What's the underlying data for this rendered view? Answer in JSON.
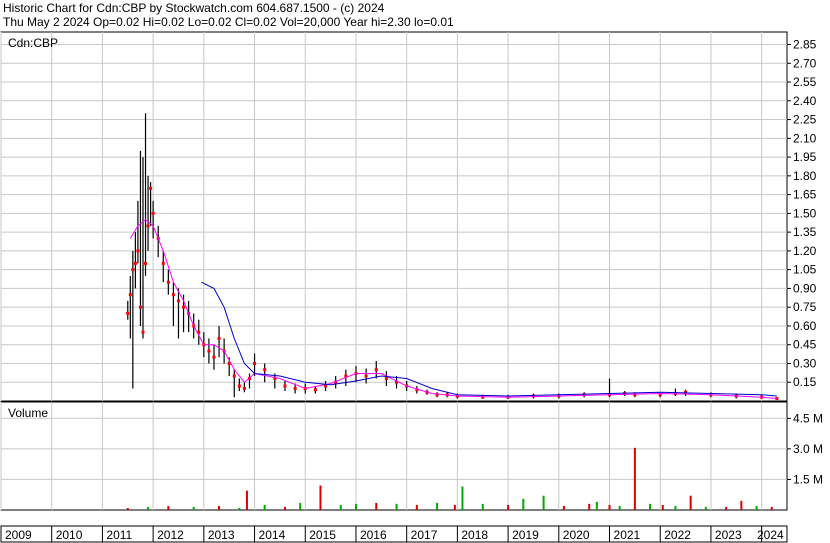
{
  "header": {
    "line1": "Historic Chart for Cdn:CBP by Stockwatch.com 604.687.1500 - (c) 2024",
    "line2": "Thu May  2 2024  Op=0.02  Hi=0.02  Lo=0.02  Cl=0.02  Vol=20,000  Year hi=2.30  lo=0.01"
  },
  "colors": {
    "price_bar": "#000000",
    "price_dot": "#ff0000",
    "ma_short": "#ff00ff",
    "ma_long": "#0000cc",
    "vol_up": "#00aa00",
    "vol_down": "#dd0000",
    "grid": "#c8c8c8"
  },
  "chart_data": [
    {
      "type": "line",
      "title": "Cdn:CBP",
      "y_ticks": [
        "2.85",
        "2.70",
        "2.55",
        "2.40",
        "2.25",
        "2.10",
        "1.95",
        "1.80",
        "1.65",
        "1.50",
        "1.35",
        "1.20",
        "1.05",
        "0.90",
        "0.75",
        "0.60",
        "0.45",
        "0.30",
        "0.15"
      ],
      "ylim": [
        0,
        2.95
      ],
      "xlim": [
        2009.0,
        2024.5
      ],
      "x_tick_labels": [
        "2009",
        "2010",
        "2011",
        "2012",
        "2013",
        "2014",
        "2015",
        "2016",
        "2017",
        "2018",
        "2019",
        "2020",
        "2021",
        "2022",
        "2023",
        "2024"
      ],
      "series": [
        {
          "kind": "price",
          "x": [
            2011.5,
            2011.55,
            2011.6,
            2011.65,
            2011.7,
            2011.75,
            2011.8,
            2011.85,
            2011.9,
            2011.95,
            2012.0,
            2012.1,
            2012.2,
            2012.3,
            2012.4,
            2012.5,
            2012.6,
            2012.7,
            2012.8,
            2012.9,
            2013.0,
            2013.1,
            2013.2,
            2013.3,
            2013.4,
            2013.5,
            2013.6,
            2013.7,
            2013.8,
            2013.9,
            2014.0,
            2014.2,
            2014.4,
            2014.6,
            2014.8,
            2015.0,
            2015.2,
            2015.4,
            2015.6,
            2015.8,
            2016.0,
            2016.2,
            2016.4,
            2016.6,
            2016.8,
            2017.0,
            2017.2,
            2017.4,
            2017.6,
            2017.8,
            2018.0,
            2018.5,
            2019.0,
            2019.5,
            2020.0,
            2020.5,
            2021.0,
            2021.3,
            2021.5,
            2022.0,
            2022.3,
            2022.5,
            2023.0,
            2023.5,
            2024.0,
            2024.3
          ],
          "y": [
            0.7,
            0.85,
            1.05,
            1.1,
            1.2,
            0.75,
            0.55,
            1.1,
            1.4,
            1.7,
            1.5,
            1.3,
            1.1,
            0.95,
            0.85,
            0.8,
            0.75,
            0.7,
            0.6,
            0.55,
            0.45,
            0.4,
            0.35,
            0.5,
            0.4,
            0.3,
            0.2,
            0.12,
            0.1,
            0.18,
            0.3,
            0.25,
            0.18,
            0.12,
            0.1,
            0.1,
            0.09,
            0.12,
            0.15,
            0.2,
            0.22,
            0.2,
            0.25,
            0.18,
            0.15,
            0.12,
            0.09,
            0.07,
            0.05,
            0.05,
            0.04,
            0.03,
            0.03,
            0.04,
            0.04,
            0.05,
            0.05,
            0.06,
            0.05,
            0.05,
            0.06,
            0.07,
            0.05,
            0.04,
            0.03,
            0.02
          ],
          "low": [
            0.65,
            0.5,
            0.1,
            0.9,
            1.1,
            0.6,
            0.5,
            1.0,
            1.2,
            1.4,
            1.3,
            1.15,
            0.95,
            0.85,
            0.6,
            0.5,
            0.55,
            0.55,
            0.5,
            0.45,
            0.35,
            0.3,
            0.25,
            0.35,
            0.3,
            0.2,
            0.03,
            0.08,
            0.07,
            0.1,
            0.2,
            0.15,
            0.1,
            0.08,
            0.06,
            0.06,
            0.06,
            0.08,
            0.1,
            0.12,
            0.15,
            0.14,
            0.18,
            0.12,
            0.1,
            0.08,
            0.06,
            0.05,
            0.03,
            0.03,
            0.02,
            0.02,
            0.02,
            0.02,
            0.02,
            0.03,
            0.03,
            0.04,
            0.03,
            0.03,
            0.04,
            0.04,
            0.03,
            0.02,
            0.02,
            0.01
          ],
          "high": [
            0.8,
            1.0,
            1.2,
            1.35,
            1.6,
            2.0,
            1.95,
            2.3,
            1.8,
            1.75,
            1.6,
            1.4,
            1.2,
            1.05,
            0.95,
            0.9,
            0.85,
            0.8,
            0.7,
            0.65,
            0.55,
            0.5,
            0.45,
            0.6,
            0.5,
            0.35,
            0.25,
            0.18,
            0.15,
            0.22,
            0.38,
            0.3,
            0.22,
            0.16,
            0.14,
            0.14,
            0.12,
            0.16,
            0.2,
            0.25,
            0.28,
            0.26,
            0.32,
            0.24,
            0.2,
            0.16,
            0.12,
            0.09,
            0.07,
            0.07,
            0.06,
            0.05,
            0.05,
            0.06,
            0.06,
            0.07,
            0.18,
            0.08,
            0.07,
            0.07,
            0.1,
            0.09,
            0.07,
            0.06,
            0.05,
            0.03
          ]
        },
        {
          "kind": "ma_short",
          "x": [
            2011.55,
            2011.7,
            2011.85,
            2012.0,
            2012.2,
            2012.4,
            2012.6,
            2012.8,
            2013.0,
            2013.2,
            2013.4,
            2013.6,
            2013.8,
            2014.0,
            2014.5,
            2015.0,
            2015.5,
            2016.0,
            2016.5,
            2017.0,
            2017.5,
            2018.0,
            2019.0,
            2020.0,
            2021.0,
            2022.0,
            2023.0,
            2024.0,
            2024.3
          ],
          "y": [
            1.3,
            1.4,
            1.45,
            1.4,
            1.2,
            0.95,
            0.8,
            0.6,
            0.45,
            0.45,
            0.4,
            0.25,
            0.15,
            0.22,
            0.18,
            0.1,
            0.14,
            0.22,
            0.22,
            0.12,
            0.06,
            0.04,
            0.03,
            0.04,
            0.05,
            0.06,
            0.05,
            0.03,
            0.02
          ]
        },
        {
          "kind": "ma_long",
          "x": [
            2012.95,
            2013.2,
            2013.4,
            2013.6,
            2013.8,
            2014.0,
            2014.5,
            2015.0,
            2015.5,
            2016.0,
            2016.5,
            2017.0,
            2017.5,
            2018.0,
            2019.0,
            2020.0,
            2021.0,
            2022.0,
            2023.0,
            2024.0,
            2024.3
          ],
          "y": [
            0.95,
            0.9,
            0.75,
            0.5,
            0.3,
            0.22,
            0.2,
            0.15,
            0.13,
            0.16,
            0.2,
            0.18,
            0.1,
            0.05,
            0.04,
            0.05,
            0.06,
            0.07,
            0.06,
            0.05,
            0.04
          ]
        }
      ]
    },
    {
      "type": "bar",
      "title": "Volume",
      "y_ticks": [
        "4.5 M",
        "3.0 M",
        "1.5 M"
      ],
      "ylim": [
        0,
        5.3
      ],
      "xlim": [
        2009.0,
        2024.5
      ],
      "x": [
        2011.5,
        2011.9,
        2012.3,
        2012.8,
        2013.3,
        2013.7,
        2013.85,
        2014.2,
        2014.6,
        2014.9,
        2015.3,
        2015.7,
        2016.0,
        2016.4,
        2016.8,
        2017.2,
        2017.6,
        2017.95,
        2018.1,
        2018.5,
        2019.0,
        2019.3,
        2019.7,
        2020.1,
        2020.6,
        2020.75,
        2021.0,
        2021.2,
        2021.5,
        2021.8,
        2022.05,
        2022.3,
        2022.6,
        2022.9,
        2023.3,
        2023.6,
        2023.9,
        2024.2
      ],
      "values": [
        0.1,
        0.15,
        0.2,
        0.15,
        0.2,
        0.1,
        0.95,
        0.25,
        0.15,
        0.35,
        1.2,
        0.25,
        0.3,
        0.35,
        0.3,
        0.25,
        0.35,
        0.25,
        1.15,
        0.3,
        0.25,
        0.55,
        0.7,
        0.2,
        0.3,
        0.4,
        0.25,
        0.2,
        3.05,
        0.3,
        0.25,
        0.2,
        0.7,
        0.15,
        0.15,
        0.45,
        0.2,
        0.15
      ],
      "up": [
        false,
        true,
        false,
        true,
        false,
        true,
        false,
        true,
        false,
        true,
        false,
        true,
        true,
        false,
        true,
        false,
        true,
        false,
        true,
        true,
        false,
        true,
        true,
        false,
        false,
        true,
        false,
        true,
        false,
        true,
        false,
        true,
        false,
        true,
        false,
        false,
        true,
        false
      ]
    }
  ]
}
